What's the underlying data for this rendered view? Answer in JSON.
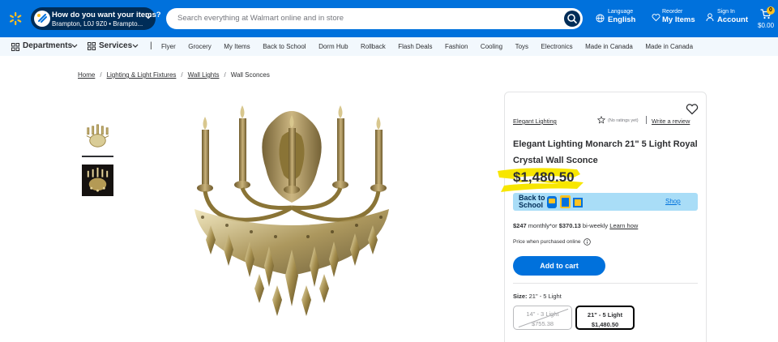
{
  "header": {
    "location": {
      "title": "How do you want your items?",
      "subtitle": "Brampton, L0J 9Z0 • Brampto..."
    },
    "search": {
      "placeholder": "Search everything at Walmart online and in store"
    },
    "language": {
      "label": "Language",
      "value": "English"
    },
    "reorder": {
      "label": "Reorder",
      "value": "My Items"
    },
    "account": {
      "label": "Sign In",
      "value": "Account"
    },
    "cart": {
      "count": "0",
      "total": "$0.00"
    }
  },
  "nav": {
    "departments": "Departments",
    "services": "Services",
    "separator": "|",
    "links": [
      "Flyer",
      "Grocery",
      "My Items",
      "Back to School",
      "Dorm Hub",
      "Rollback",
      "Flash Deals",
      "Fashion",
      "Cooling",
      "Toys",
      "Electronics",
      "Made in Canada",
      "Made in Canada"
    ]
  },
  "breadcrumb": {
    "items": [
      "Home",
      "Lighting & Light Fixtures",
      "Wall Lights"
    ],
    "separator": "/",
    "current": "Wall Sconces"
  },
  "product": {
    "brand": "Elegant Lighting",
    "ratings": "(No ratings yet)",
    "write_review": "Write a review",
    "title": "Elegant Lighting Monarch 21\" 5 Light Royal Crystal Wall Sconce",
    "price": "$1,480.50",
    "promo": {
      "line1": "Back to",
      "line2": "School",
      "link": "Shop"
    },
    "financing": {
      "monthly_amount": "$247",
      "monthly_text": " monthly*or ",
      "biweekly_amount": "$370.13",
      "biweekly_text": " bi-weekly ",
      "link": "Learn how"
    },
    "price_note": "Price when purchased online",
    "add_to_cart": "Add to cart",
    "size": {
      "label": "Size:",
      "selected": "21\" - 5 Light",
      "options": [
        {
          "name": "14\" - 3 Light",
          "price": "$755.38",
          "available": false
        },
        {
          "name": "21\" - 5 Light",
          "price": "$1,480.50",
          "available": true,
          "selected": true
        }
      ]
    }
  },
  "colors": {
    "brand_blue": "#0071dc",
    "dark_blue": "#002d58",
    "spark_yellow": "#ffc220",
    "highlight_yellow": "#f7e600",
    "promo_bg": "#a9ddf7"
  }
}
